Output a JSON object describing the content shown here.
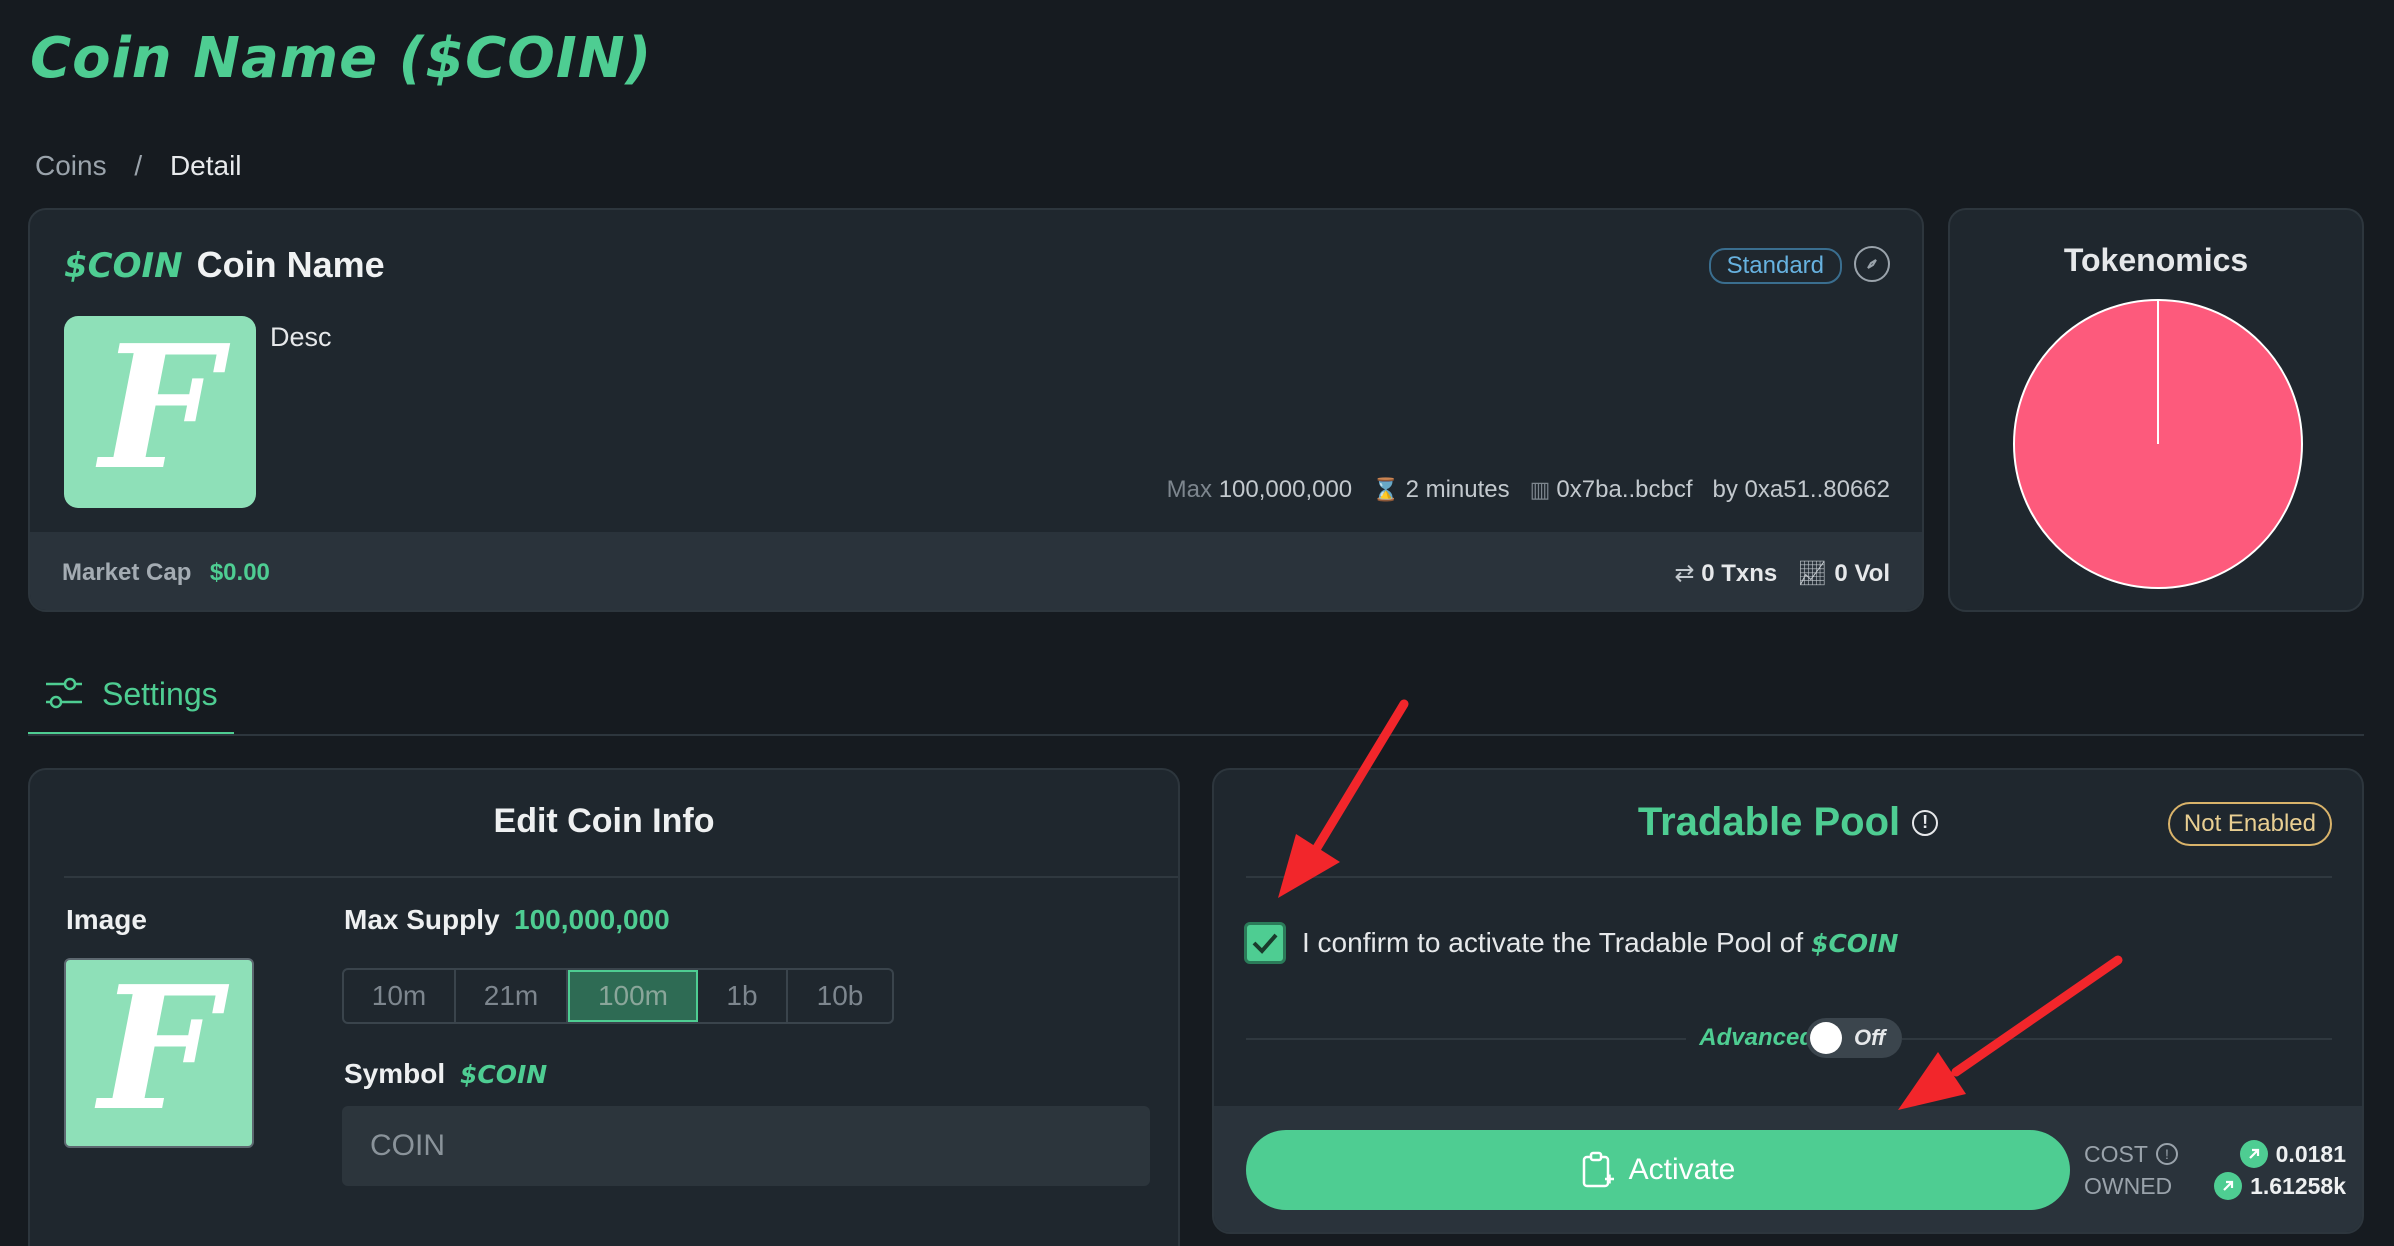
{
  "page": {
    "title": "Coin Name  ($COIN)"
  },
  "breadcrumb": {
    "items": [
      "Coins",
      "Detail"
    ],
    "separator": "/"
  },
  "coin": {
    "symbol": "$COIN",
    "name": "Coin Name",
    "type_badge": "Standard",
    "description": "Desc",
    "max_label": "Max",
    "max_supply": "100,000,000",
    "age": "2 minutes",
    "contract": "0x7ba..bcbcf",
    "creator": "by 0xa51..80662",
    "market_cap_label": "Market Cap",
    "market_cap_value": "$0.00",
    "txns_value": "0",
    "txns_label": "Txns",
    "vol_value": "0",
    "vol_label": "Vol",
    "logo_letter": "F"
  },
  "tokenomics": {
    "title": "Tokenomics",
    "slice_fraction": 1.0,
    "color": "#fd5a7c"
  },
  "tabs": {
    "settings_label": "Settings"
  },
  "edit": {
    "title": "Edit Coin Info",
    "image_label": "Image",
    "max_supply_label": "Max Supply",
    "max_supply_value": "100,000,000",
    "supply_options": [
      "10m",
      "21m",
      "100m",
      "1b",
      "10b"
    ],
    "supply_selected": "100m",
    "symbol_label": "Symbol",
    "symbol_value": "$COIN",
    "symbol_input_placeholder": "COIN"
  },
  "pool": {
    "title": "Tradable Pool",
    "status_badge": "Not Enabled",
    "confirm_text": "I confirm to activate the Tradable Pool of",
    "confirm_symbol": "$COIN",
    "confirm_checked": true,
    "advanced_label": "Advanced",
    "advanced_state": "Off",
    "activate_label": "Activate",
    "cost_label": "COST",
    "cost_value": "0.0181",
    "owned_label": "OWNED",
    "owned_value": "1.61258k"
  },
  "colors": {
    "accent": "#4ecd92",
    "background": "#161b20",
    "card": "#1f272e",
    "annotation_arrow": "#f2262b"
  },
  "icons": [
    "compass-icon",
    "clock-tree-icon",
    "contract-icon",
    "swap-icon",
    "chart-icon",
    "sliders-icon",
    "info-icon",
    "check-icon",
    "clipboard-add-icon",
    "token-icon"
  ]
}
